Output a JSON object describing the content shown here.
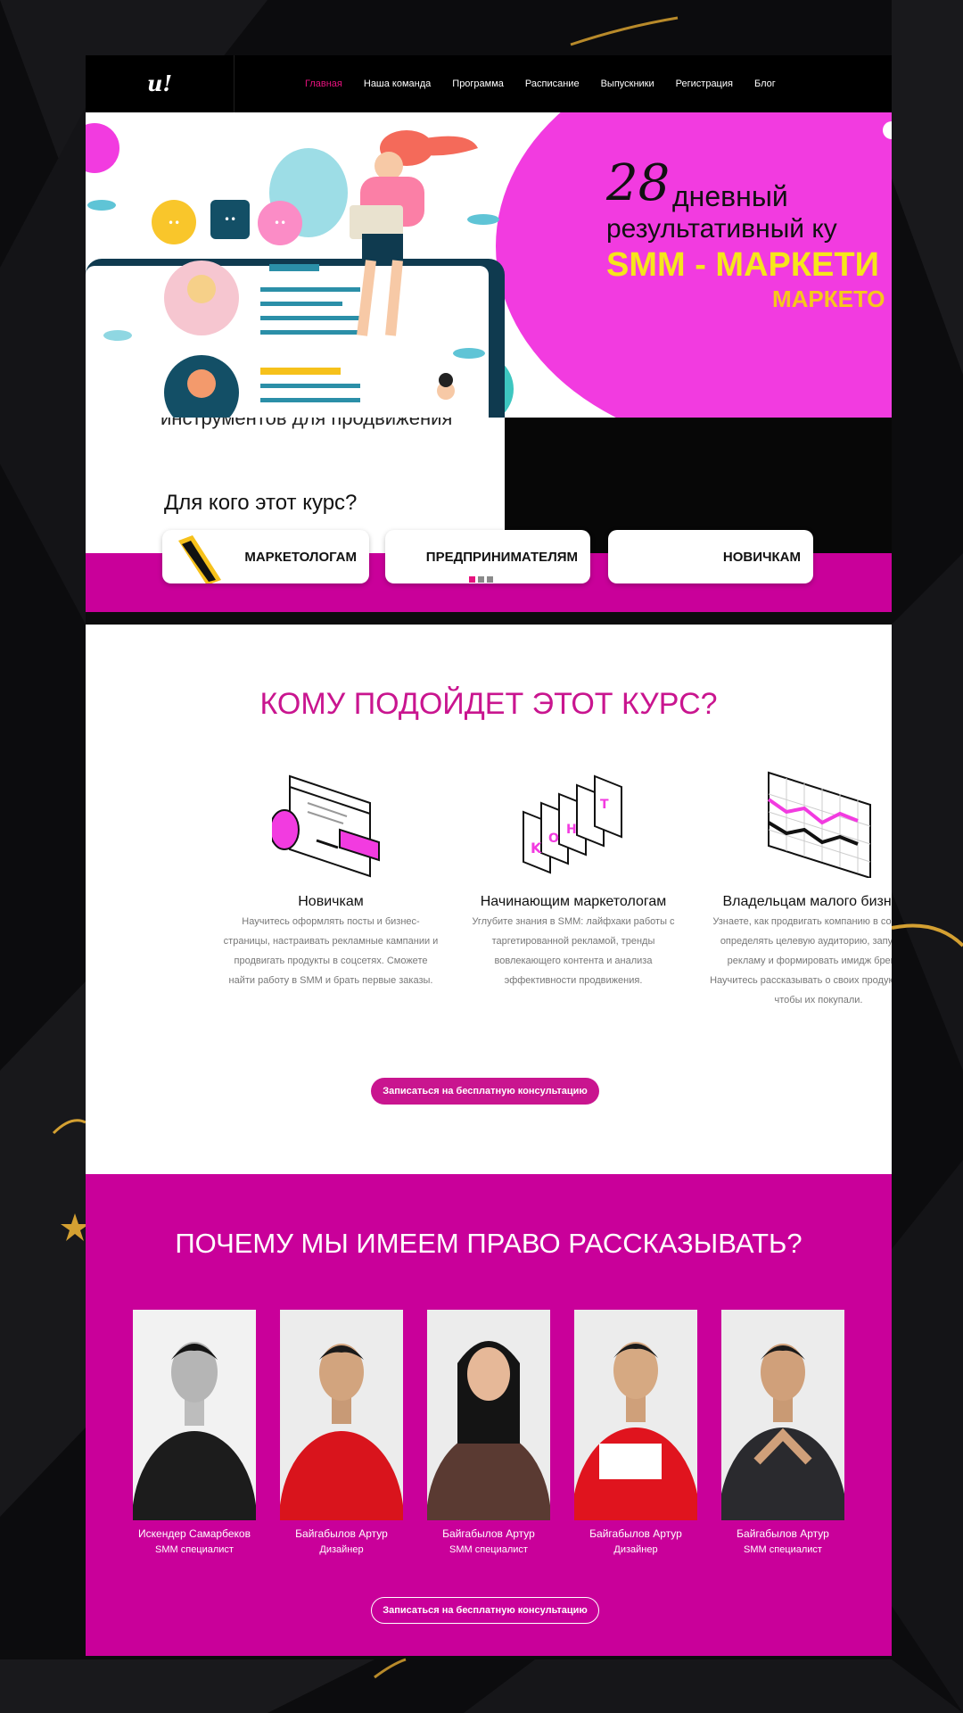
{
  "nav": {
    "logo": "u!",
    "items": [
      "Главная",
      "Наша команда",
      "Программа",
      "Расписание",
      "Выпускники",
      "Регистрация",
      "Блог"
    ],
    "active_index": 0
  },
  "hero": {
    "number": "28",
    "line1": "дневный",
    "line2": "результативный ку",
    "line3": "SMM - МАРКЕТИ",
    "line4": "МАРКЕТО"
  },
  "slide2": {
    "cut_text": "инструментов для продвижения",
    "question": "Для кого этот курс?",
    "cards": [
      "МАРКЕТОЛОГАМ",
      "ПРЕДПРИНИМАТЕЛЯМ",
      "НОВИЧКАМ"
    ],
    "slides_total": 3,
    "slide_active": 1
  },
  "audience": {
    "title": "КОМУ ПОДОЙДЕТ ЭТОТ КУРС?",
    "columns": [
      {
        "icon": "browser-window-icon",
        "heading": "Новичкам",
        "lines": [
          "Научитесь оформлять посты и бизнес-",
          "страницы, настраивать рекламные кампании и",
          "продвигать продукты в соцсетях. Сможете",
          "найти работу в SMM и брать первые заказы."
        ]
      },
      {
        "icon": "stacked-cards-icon",
        "heading": "Начинающим маркетологам",
        "lines": [
          "Углубите знания в SMM: лайфхаки работы с",
          "таргетированной рекламой, тренды",
          "вовлекающего контента и анализа",
          "эффективности продвижения."
        ]
      },
      {
        "icon": "line-graph-icon",
        "heading": "Владельцам малого бизнеса",
        "lines": [
          "Узнаете, как продвигать компанию в соцсетях:",
          "определять целевую аудиторию, запускать",
          "рекламу и формировать имидж бренда.",
          "Научитесь рассказывать о своих продуктах так,",
          "чтобы их покупали."
        ]
      }
    ],
    "cta": "Записаться на бесплатную консультацию"
  },
  "team": {
    "title": "ПОЧЕМУ МЫ ИМЕЕМ ПРАВО РАССКАЗЫВАТЬ?",
    "members": [
      {
        "name": "Искендер Самарбеков",
        "role": "SMM специалист",
        "shirt": "#1c1c1c"
      },
      {
        "name": "Байгабылов Артур",
        "role": "Дизайнер",
        "shirt": "#d9141c"
      },
      {
        "name": "Байгабылов Артур",
        "role": "SMM специалист",
        "shirt": "#5a3a32"
      },
      {
        "name": "Байгабылов Артур",
        "role": "Дизайнер",
        "shirt": "#e0141e"
      },
      {
        "name": "Байгабылов Артур",
        "role": "SMM специалист",
        "shirt": "#2a2a2e"
      }
    ],
    "cta": "Записаться на бесплатную консультацию"
  },
  "colors": {
    "accent": "#c9158f",
    "magenta_band": "#c9009a",
    "hero_pink": "#f23be0",
    "nav_active": "#e6127e",
    "yellow": "#f6e61b"
  }
}
